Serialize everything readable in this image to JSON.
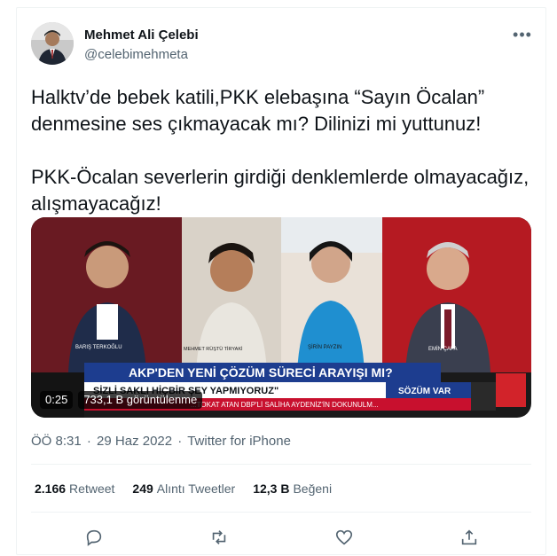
{
  "author": {
    "display_name": "Mehmet Ali Çelebi",
    "handle": "@celebimehmeta"
  },
  "more_glyph": "•••",
  "tweet": {
    "text": "Halktv’de bebek katili,PKK elebaşına “Sayın Öcalan” denmesine ses çıkmayacak mı? Dilinizi mi yuttunuz!\n\nPKK-Öcalan severlerin girdiği denklemlerde olmayacağız, alışmayacağız!"
  },
  "video": {
    "duration": "0:25",
    "views": "733,1 B görüntülenme",
    "headline": "AKP'DEN YENİ ÇÖZÜM SÜRECİ ARAYIŞI MI?",
    "subline": "SİZLİ SAKLI HİÇBİR ŞEY YAPMIYORUZ\"",
    "ticker": "...TOKAT ATAN DBP'Lİ SALİHA AYDENİZ'İN DOKUNULM...",
    "brand": "SÖZÜM VAR",
    "person_labels": [
      "BARIŞ TERKOĞLU",
      "MEHMET RÜŞTÜ TİRYAKİ",
      "ŞİRİN PAYZIN",
      "EMİN ÇAPA"
    ]
  },
  "meta": {
    "time": "ÖÖ 8:31",
    "date": "29 Haz 2022",
    "source": "Twitter for iPhone",
    "separator": "·"
  },
  "stats": [
    {
      "count": "2.166",
      "label": "Retweet"
    },
    {
      "count": "249",
      "label": "Alıntı Tweetler"
    },
    {
      "count": "12,3 B",
      "label": "Beğeni"
    }
  ],
  "actions": [
    {
      "name": "reply-icon"
    },
    {
      "name": "retweet-icon"
    },
    {
      "name": "like-icon"
    },
    {
      "name": "share-icon"
    }
  ],
  "colors": {
    "text": "#0f1419",
    "secondary": "#536471",
    "divider": "#eff3f4",
    "news_red": "#c8102e",
    "news_blue": "#1d3d8f"
  }
}
